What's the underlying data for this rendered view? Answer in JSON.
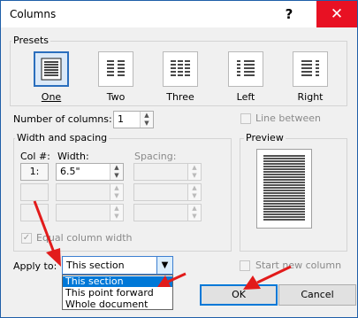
{
  "window": {
    "title": "Columns",
    "help_label": "?",
    "close_label": "✕"
  },
  "presets": {
    "group_title": "Presets",
    "items": [
      {
        "label": "One",
        "selected": true
      },
      {
        "label": "Two",
        "selected": false
      },
      {
        "label": "Three",
        "selected": false
      },
      {
        "label": "Left",
        "selected": false
      },
      {
        "label": "Right",
        "selected": false
      }
    ]
  },
  "number_of_columns": {
    "label": "Number of columns:",
    "value": "1"
  },
  "line_between": {
    "label": "Line between",
    "checked": false
  },
  "width_spacing": {
    "group_title": "Width and spacing",
    "col_header": "Col #:",
    "width_header": "Width:",
    "spacing_header": "Spacing:",
    "rows": [
      {
        "col": "1:",
        "width": "6.5\"",
        "spacing": ""
      },
      {
        "col": "",
        "width": "",
        "spacing": ""
      },
      {
        "col": "",
        "width": "",
        "spacing": ""
      }
    ],
    "equal_width_label": "Equal column width",
    "equal_width_checked": true
  },
  "preview": {
    "group_title": "Preview"
  },
  "apply_to": {
    "label": "Apply to:",
    "selected": "This section",
    "options": [
      "This section",
      "This point forward",
      "Whole document"
    ]
  },
  "start_new_column": {
    "label": "Start new column",
    "checked": false
  },
  "buttons": {
    "ok": "OK",
    "cancel": "Cancel"
  },
  "colors": {
    "accent": "#0078d7",
    "close": "#e81123",
    "annotation_arrow": "#e21b1b"
  }
}
